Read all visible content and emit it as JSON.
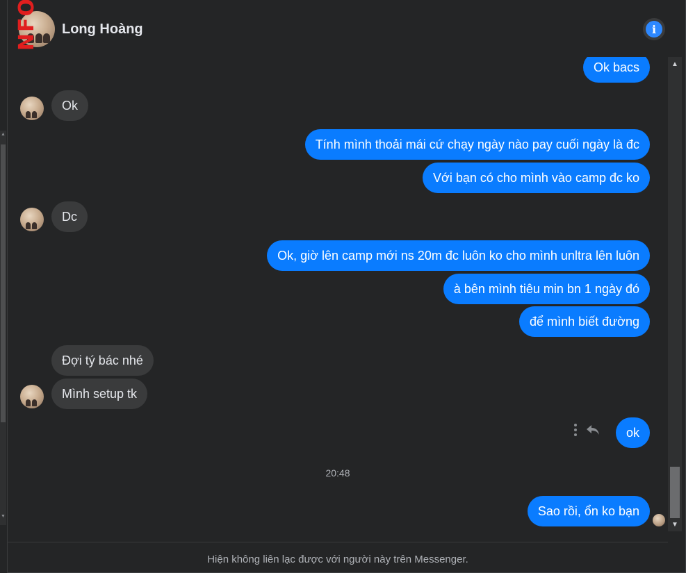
{
  "header": {
    "watermark": "NFO",
    "contact_name": "Long Hoàng",
    "info_icon": "info-icon"
  },
  "messages": [
    {
      "dir": "out",
      "text": "Ok bacs"
    },
    {
      "dir": "in",
      "text": "Ok"
    },
    {
      "dir": "out",
      "text": "Tính mình thoải mái cứ chạy ngày nào pay cuối ngày là đc"
    },
    {
      "dir": "out",
      "text": "Với bạn có cho mình vào camp đc ko"
    },
    {
      "dir": "in",
      "text": "Dc"
    },
    {
      "dir": "out",
      "text": "Ok, giờ lên camp mới ns 20m đc luôn ko cho mình unltra lên luôn"
    },
    {
      "dir": "out",
      "text": "à bên mình tiêu min bn 1 ngày đó"
    },
    {
      "dir": "out",
      "text": "để mình biết đường"
    },
    {
      "dir": "in",
      "text": "Đợi tý bác nhé"
    },
    {
      "dir": "in",
      "text": "Mình setup tk"
    },
    {
      "dir": "out",
      "text": "ok"
    },
    {
      "dir": "out",
      "text": "Sao rồi, ổn ko bạn"
    }
  ],
  "timestamp": "20:48",
  "footer": {
    "notice": "Hiện không liên lạc được với người này trên Messenger."
  },
  "colors": {
    "background": "#242526",
    "outgoing_bubble": "#0a7cff",
    "incoming_bubble": "#3a3b3c",
    "info_accent": "#2d88ff",
    "watermark": "#e01e1e"
  }
}
